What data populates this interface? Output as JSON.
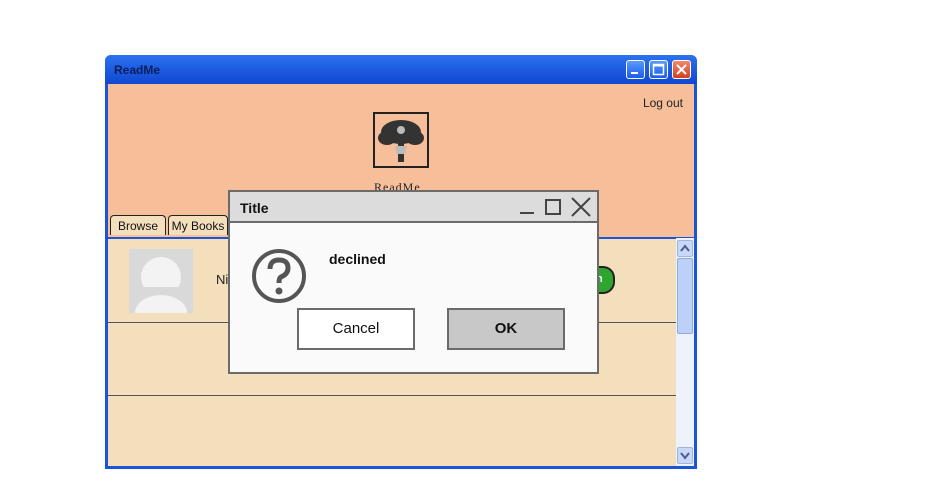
{
  "window": {
    "title": "ReadMe"
  },
  "header": {
    "logout_label": "Log out",
    "logo_text": "ReadMe"
  },
  "tabs": [
    {
      "label": "Browse"
    },
    {
      "label": "My Books"
    }
  ],
  "list": {
    "row_name_partial": "Ni",
    "action_partial": "n"
  },
  "dialog": {
    "title": "Title",
    "message": "declined",
    "cancel_label": "Cancel",
    "ok_label": "OK"
  },
  "colors": {
    "window_blue": "#1a55d9",
    "header_peach": "#f7be9a",
    "content_tan": "#f4dfbd",
    "action_green": "#2ea52e"
  },
  "icons": [
    "minimize-icon",
    "maximize-icon",
    "close-icon",
    "tree-logo-icon",
    "question-icon",
    "scroll-up-icon",
    "scroll-down-icon"
  ]
}
